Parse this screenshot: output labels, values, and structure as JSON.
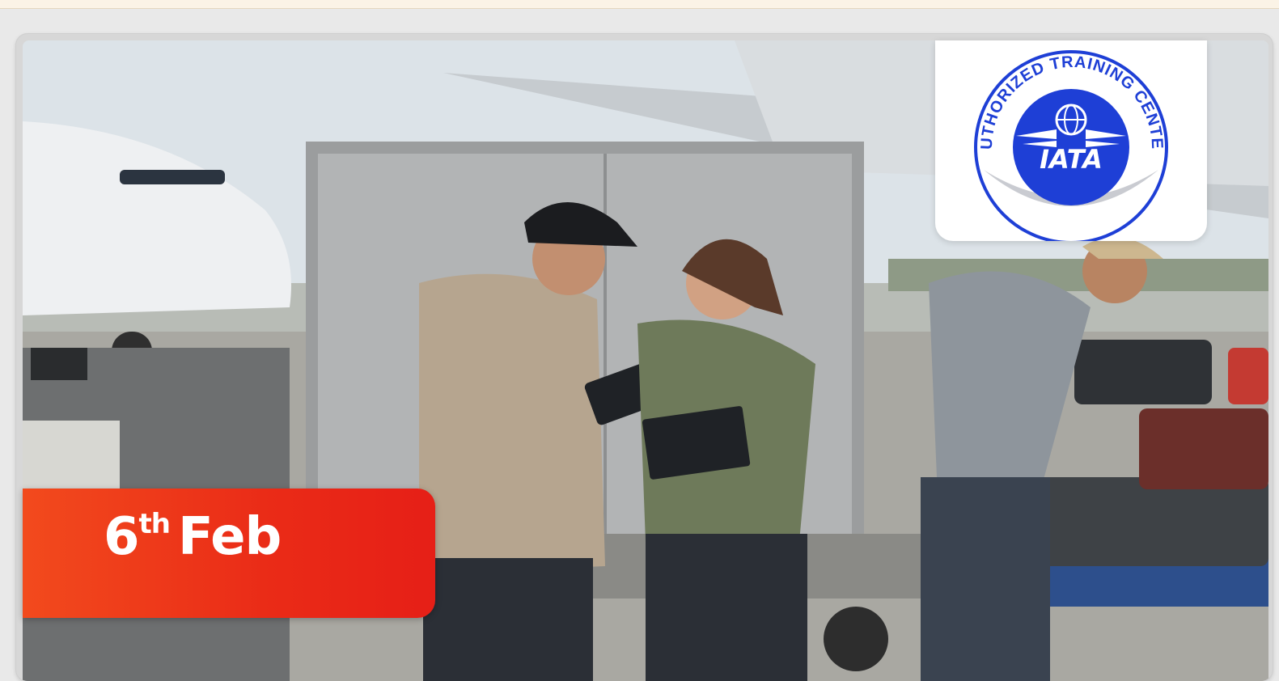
{
  "banner": {
    "date_day": "6",
    "date_suffix": "th",
    "date_month": "Feb"
  },
  "logo": {
    "arc_text": "AUTHORIZED TRAINING CENTER",
    "brand": "IATA",
    "icon": "iata-globe-wings-icon"
  },
  "colors": {
    "badge_red": "#ea2b17",
    "iata_blue": "#1e3fd6"
  }
}
